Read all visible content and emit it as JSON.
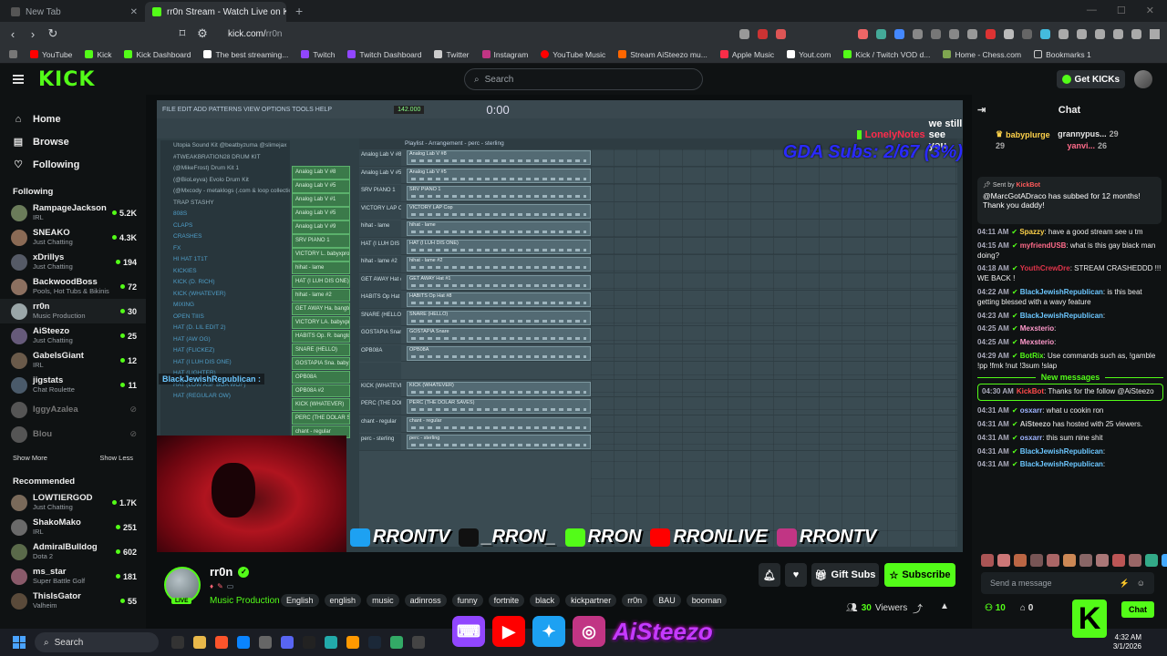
{
  "browser": {
    "tabs": [
      {
        "title": "New Tab",
        "active": false
      },
      {
        "title": "rr0n Stream - Watch Live on K",
        "active": true
      }
    ],
    "url_host": "kick.com/",
    "url_path": "rr0n",
    "bookmarks": [
      "YouTube",
      "Kick",
      "Kick Dashboard",
      "The best streaming...",
      "Twitch",
      "Twitch Dashboard",
      "Twitter",
      "Instagram",
      "YouTube Music",
      "Stream AiSteezo mu...",
      "Apple Music",
      "Yout.com",
      "Kick / Twitch VOD d...",
      "Home - Chess.com",
      "Bookmarks 1"
    ]
  },
  "header": {
    "logo": "KICK",
    "search_placeholder": "Search",
    "get_kicks": "Get KICKs"
  },
  "sidebar": {
    "nav": [
      {
        "label": "Home",
        "icon": "home-icon"
      },
      {
        "label": "Browse",
        "icon": "browse-icon"
      },
      {
        "label": "Following",
        "icon": "heart-icon"
      }
    ],
    "following_title": "Following",
    "following": [
      {
        "name": "RampageJackson",
        "category": "IRL",
        "viewers": "5.2K",
        "color": "#6b7c5a"
      },
      {
        "name": "SNEAKO",
        "category": "Just Chatting",
        "viewers": "4.3K",
        "color": "#8a6a55"
      },
      {
        "name": "xDrillys",
        "category": "Just Chatting",
        "viewers": "194",
        "color": "#555a66"
      },
      {
        "name": "BackwoodBoss",
        "category": "Pools, Hot Tubs & Bikinis",
        "viewers": "72",
        "color": "#8c7060"
      },
      {
        "name": "rr0n",
        "category": "Music Production",
        "viewers": "30",
        "color": "#9aa6a8"
      },
      {
        "name": "AiSteezo",
        "category": "Just Chatting",
        "viewers": "25",
        "color": "#665a7a"
      },
      {
        "name": "GabelsGiant",
        "category": "IRL",
        "viewers": "12",
        "color": "#6a5a4a"
      },
      {
        "name": "jigstats",
        "category": "Chat Roulette",
        "viewers": "11",
        "color": "#4a5a6a"
      },
      {
        "name": "IggyAzalea",
        "category": "",
        "viewers": "",
        "color": "#555"
      },
      {
        "name": "Blou",
        "category": "",
        "viewers": "",
        "color": "#555"
      }
    ],
    "show_more": "Show More",
    "show_less": "Show Less",
    "recommended_title": "Recommended",
    "recommended": [
      {
        "name": "LOWTIERGOD",
        "category": "Just Chatting",
        "viewers": "1.7K",
        "color": "#7a6a5a"
      },
      {
        "name": "ShakoMako",
        "category": "IRL",
        "viewers": "251",
        "color": "#6a6a6a"
      },
      {
        "name": "AdmiralBulldog",
        "category": "Dota 2",
        "viewers": "602",
        "color": "#5a6a4a"
      },
      {
        "name": "ms_star",
        "category": "Super Battle Golf",
        "viewers": "181",
        "color": "#8a5a6a"
      },
      {
        "name": "ThisIsGator",
        "category": "Valheim",
        "viewers": "55",
        "color": "#5a4a3a"
      }
    ]
  },
  "player": {
    "fl_menu": "FILE EDIT ADD PATTERNS VIEW OPTIONS TOOLS HELP",
    "bpm": "142.000",
    "time": "0:00",
    "playlist_title": "Playlist - Arrangement - perc - sterling",
    "browser_items": [
      "Utopia Sound Kit @beatbyzuma @slimejax",
      "#TWEAKBRATION28 DRUM KIT",
      "(@MikeFrost) Drum Kit 1",
      "(@BioLeyva) Evolo Drum Kit",
      "(@Mxcody - metaklogs (.com & loop collection)",
      "TRAP STASHY",
      "808S",
      "CLAPS",
      "CRASHES",
      "FX",
      "HI HAT 1T1T",
      "KICKIES",
      "KICK (D. RICH)",
      "KICK (WHATEVER)",
      "MIXING",
      "OPEN TIIIS",
      "HAT (D. LIL EDIT 2)",
      "HAT (AW OG)",
      "HAT (FLICKEZ)",
      "HAT (I LUH DIS ONE)",
      "HAT (LIGHTER)",
      "HAT (LOW ASF BOA WOF)",
      "HAT (REGULAR OW)"
    ],
    "rack_items": [
      "Analog Lab V #8",
      "Analog Lab V #5",
      "Analog Lab V #1",
      "Analog Lab V #5",
      "Analog Lab V #9",
      "SRV PIANO 1",
      "VICTORY L. babyxprod",
      "hihat - lame",
      "HAT (I LUH DIS ONE)",
      "hihat - lame #2",
      "GET AWAY Ha. bangtoy",
      "VICTORY LA. babyxprod",
      "HABITS Op. R. bangtoy",
      "SNARE (HELLO)",
      "GOSTAPIA Sna. babyxprod",
      "OPB08A",
      "OPB08A #2",
      "KICK (WHATEVER)",
      "PERC (THE DOLAR SAVES)",
      "chant - regular"
    ],
    "tracks": [
      "Analog Lab V #8",
      "Analog Lab V #5",
      "SRV PIANO 1",
      "VICTORY LAP Cop",
      "hihat - lame",
      "HAT (I LUH DIS ONE)",
      "hihat - lame #2",
      "GET AWAY Hat #1",
      "HABITS Op Hat #8",
      "SNARE (HELLO)",
      "GOSTAPIA Snare",
      "OPB08A",
      "",
      "KICK (WHATEVER)",
      "PERC (THE DOLAR SAVES)",
      "chant - regular",
      "perc - sterling"
    ],
    "overlay_user": "LonelyNotes",
    "overlay_text": "we still see you",
    "goal": "GDA Subs: 2/67 (3%)",
    "bjr_overlay": "BlackJewishRepublican :",
    "socials": [
      {
        "label": "RRONTV",
        "color": "#1da1f2"
      },
      {
        "label": "_RRON_",
        "color": "#111"
      },
      {
        "label": "RRON",
        "color": "#53fc18"
      },
      {
        "label": "RRONLIVE",
        "color": "#ff0000"
      },
      {
        "label": "RRONTV",
        "color": "#c13584"
      }
    ]
  },
  "stream_info": {
    "name": "rr0n",
    "live": "LIVE",
    "category": "Music Production",
    "tags": [
      "English",
      "english",
      "music",
      "adinross",
      "funny",
      "fortnite",
      "black",
      "kickpartner",
      "rr0n",
      "BAU",
      "booman"
    ],
    "gift_subs": "Gift Subs",
    "subscribe": "Subscribe",
    "viewers_count": "30",
    "viewers_label": "Viewers"
  },
  "chat": {
    "title": "Chat",
    "gifters": [
      {
        "name": "babyplurge",
        "count": "29"
      },
      {
        "name": "grannypus...",
        "count": "29"
      },
      {
        "name": "yanvi...",
        "count": "26"
      }
    ],
    "pinned_sentby": "Sent by",
    "pinned_user": "KickBot",
    "pinned_text": "@MarcGotADraco has subbed for 12 months! Thank you daddy!",
    "messages": [
      {
        "time": "04:11 AM",
        "user": "Spazzy",
        "color": "#ffd24a",
        "text": ": have a good stream see u tm"
      },
      {
        "time": "04:15 AM",
        "user": "myfriendUSB",
        "color": "#ff6b8a",
        "text": ": what is this gay black man doing?"
      },
      {
        "time": "04:18 AM",
        "user": "YouthCrewDre",
        "color": "#e0344a",
        "text": ": STREAM CRASHEDDD !!! WE BACK !"
      },
      {
        "time": "04:22 AM",
        "user": "BlackJewishRepublican",
        "color": "#6cc7ff",
        "text": ": is this beat getting blessed with a wavy feature"
      },
      {
        "time": "04:23 AM",
        "user": "BlackJewishRepublican",
        "color": "#6cc7ff",
        "text": ":"
      },
      {
        "time": "04:25 AM",
        "user": "Mexsterio",
        "color": "#ff9acb",
        "text": ":"
      },
      {
        "time": "04:25 AM",
        "user": "Mexsterio",
        "color": "#ff9acb",
        "text": ":"
      },
      {
        "time": "04:29 AM",
        "user": "BotRix",
        "color": "#53fc18",
        "text": ": Use commands such as, !gamble !pp !fmk !nut !3sum !slap"
      }
    ],
    "new_messages": "New messages",
    "bot_message": {
      "time": "04:30 AM",
      "user": "KickBot",
      "color": "#ff4b4b",
      "text": ": Thanks for the follow @AiSteezo"
    },
    "messages2": [
      {
        "time": "04:31 AM",
        "user": "osxarr",
        "color": "#9fb4ff",
        "text": ": what u cookin ron"
      },
      {
        "time": "04:31 AM",
        "user": "AiSteezo",
        "color": "#cccccc",
        "text": " has hosted with 25 viewers."
      },
      {
        "time": "04:31 AM",
        "user": "osxarr",
        "color": "#9fb4ff",
        "text": ": this sum nine shit"
      },
      {
        "time": "04:31 AM",
        "user": "BlackJewishRepublican",
        "color": "#6cc7ff",
        "text": ":"
      },
      {
        "time": "04:31 AM",
        "user": "BlackJewishRepublican",
        "color": "#6cc7ff",
        "text": ":"
      }
    ],
    "input_placeholder": "Send a message",
    "kicks_count": "10",
    "sub_count": "0",
    "chat_button": "Chat"
  },
  "taskbar": {
    "search": "Search",
    "time": "4:32 AM",
    "date": "3/1/2026",
    "promo_name": "AiSteezo"
  }
}
